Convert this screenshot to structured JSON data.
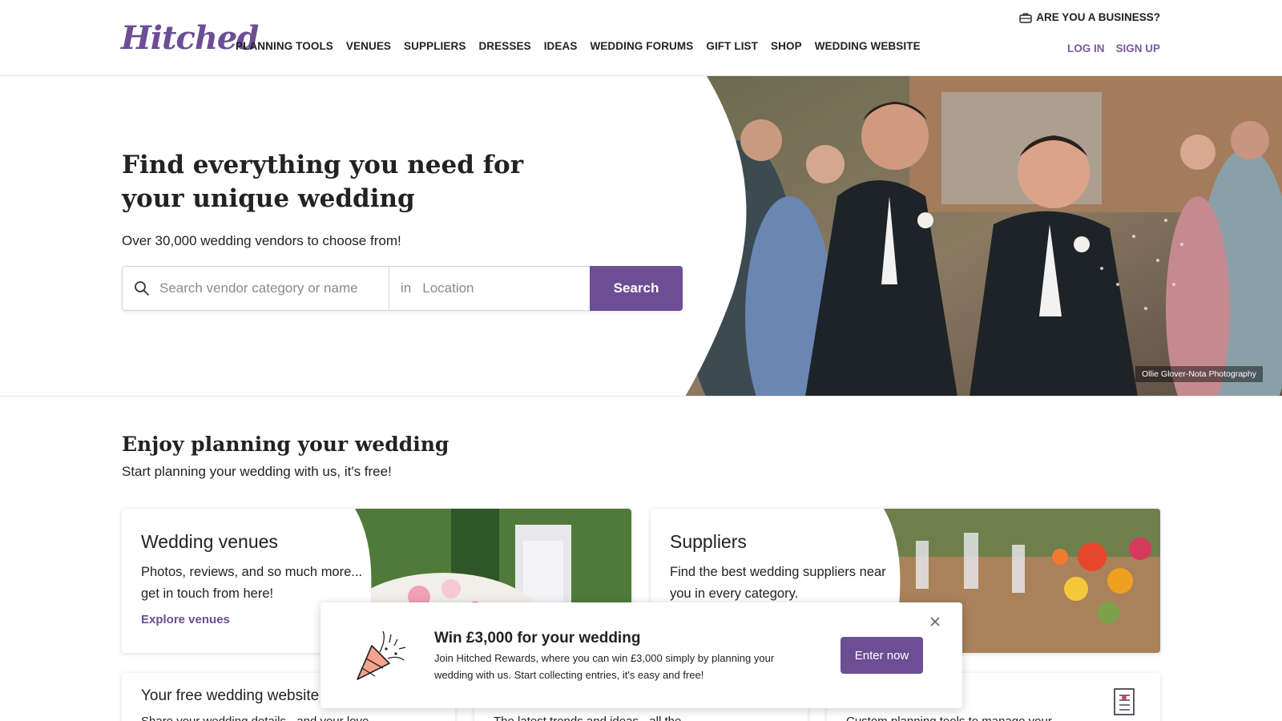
{
  "header": {
    "logo": "Hitched",
    "nav": [
      "PLANNING TOOLS",
      "VENUES",
      "SUPPLIERS",
      "DRESSES",
      "IDEAS",
      "WEDDING FORUMS",
      "GIFT LIST",
      "SHOP",
      "WEDDING WEBSITE"
    ],
    "business_link": "ARE YOU A BUSINESS?",
    "login": "LOG IN",
    "signup": "SIGN UP"
  },
  "hero": {
    "title": "Find everything you need for your unique wedding",
    "subtitle": "Over 30,000 wedding vendors to choose from!",
    "search": {
      "category_placeholder": "Search vendor category or name",
      "in_label": "in",
      "location_placeholder": "Location",
      "button": "Search"
    },
    "photo_credit": "Ollie Glover-Nota Photography"
  },
  "planning": {
    "title": "Enjoy planning your wedding",
    "subtitle": "Start planning your wedding with us, it's free!",
    "cards": [
      {
        "title": "Wedding venues",
        "desc": "Photos, reviews, and so much more... get in touch from here!",
        "link": "Explore venues"
      },
      {
        "title": "Suppliers",
        "desc": "Find the best wedding suppliers near you in every category."
      }
    ],
    "small_cards": [
      {
        "title": "Your free wedding website",
        "desc": "Share your wedding details - and your love"
      },
      {
        "desc": "The latest trends and ideas - all the"
      },
      {
        "desc": "Custom planning tools to manage your"
      }
    ]
  },
  "popup": {
    "title": "Win £3,000 for your wedding",
    "text": "Join Hitched Rewards, where you can win £3,000 simply by planning your wedding with us. Start collecting entries, it's easy and free!",
    "button": "Enter now"
  },
  "colors": {
    "brand": "#6d4d94",
    "text": "#222222"
  }
}
